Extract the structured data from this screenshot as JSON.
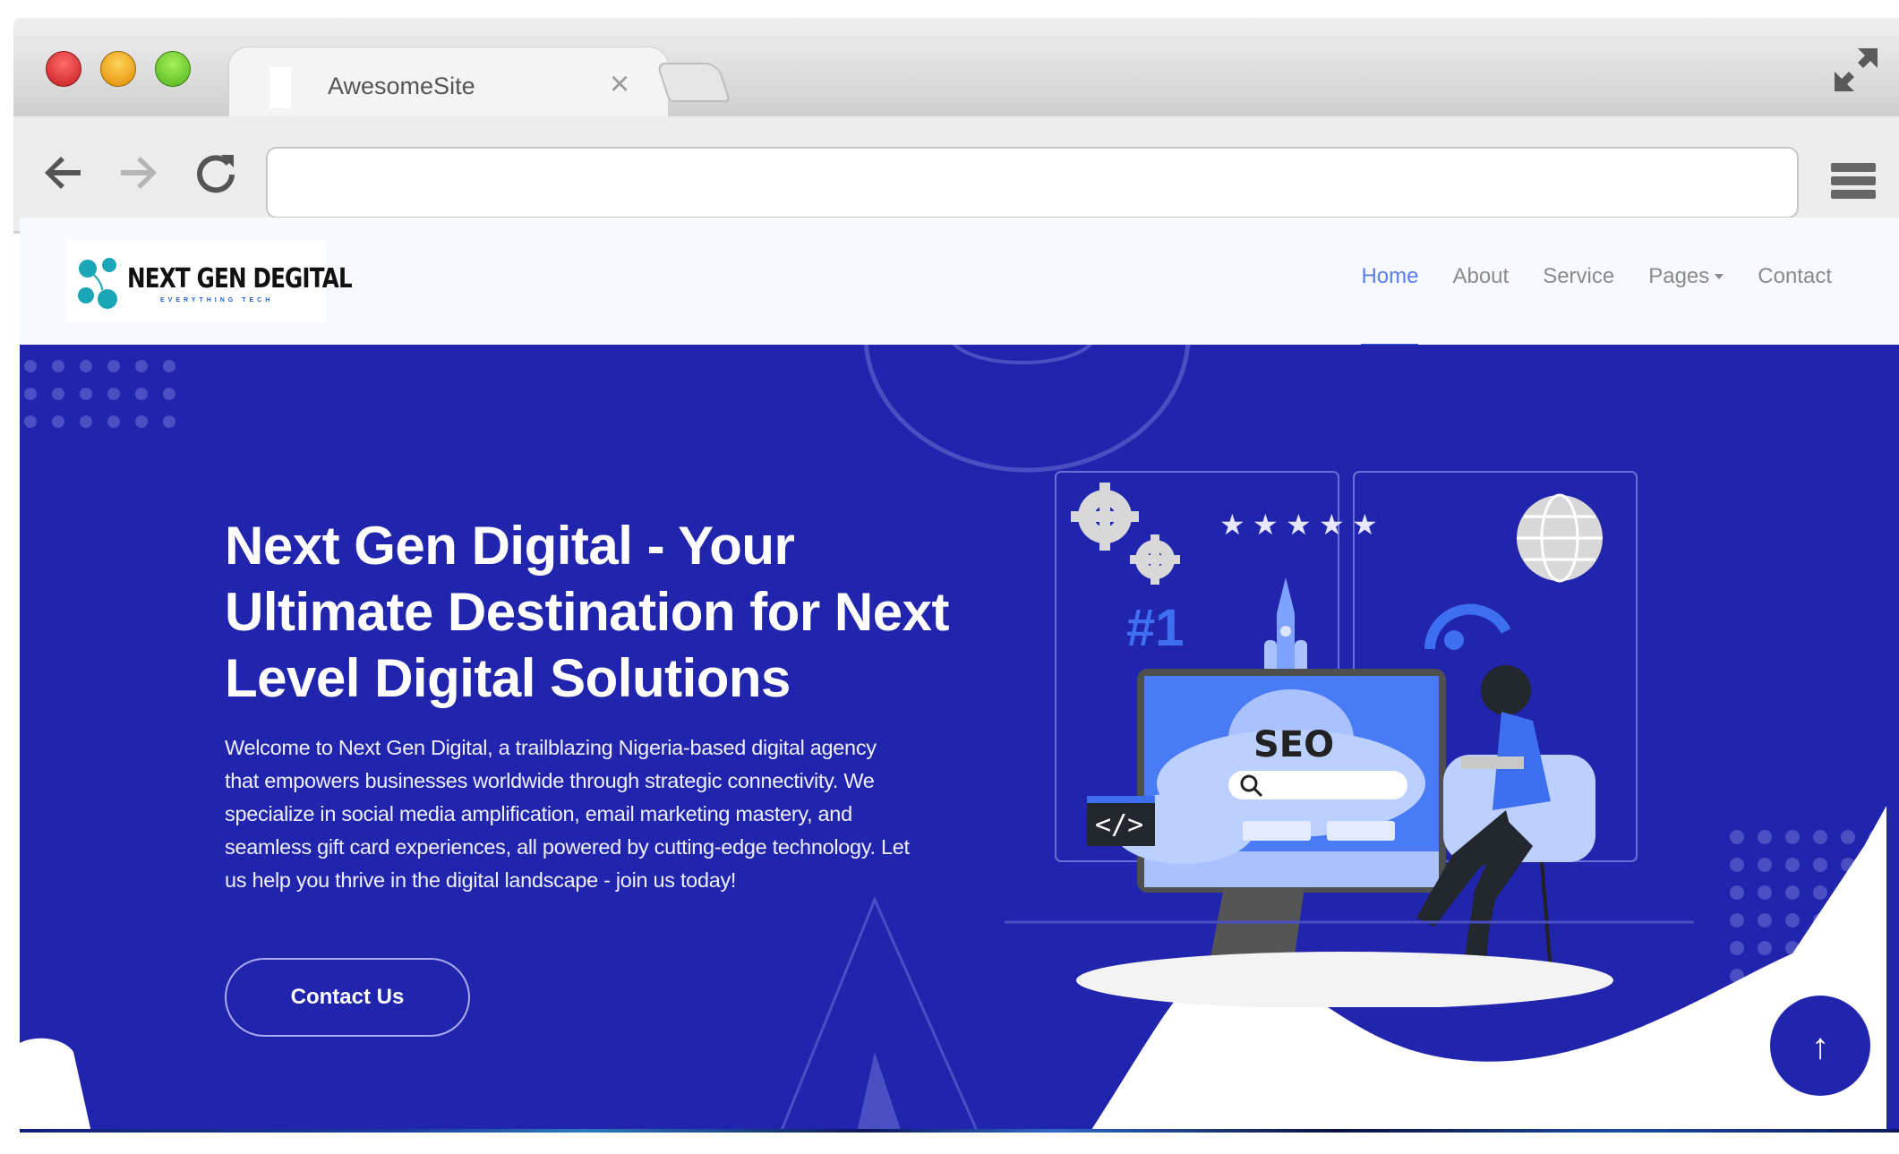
{
  "browser": {
    "tab_title": "AwesomeSite",
    "address_value": "",
    "icons": {
      "close": "close-icon",
      "back": "back-arrow-icon",
      "forward": "forward-arrow-icon",
      "reload": "reload-icon",
      "fullscreen": "fullscreen-icon",
      "menu": "hamburger-menu-icon"
    }
  },
  "site": {
    "logo": {
      "name": "NEXT GEN DEGITAL",
      "tagline": "EVERYTHING TECH",
      "color": "#1aa6b7"
    },
    "nav": [
      {
        "label": "Home",
        "active": true
      },
      {
        "label": "About",
        "active": false
      },
      {
        "label": "Service",
        "active": false
      },
      {
        "label": "Pages",
        "active": false,
        "dropdown": true
      },
      {
        "label": "Contact",
        "active": false
      }
    ],
    "hero": {
      "title": "Next Gen Digital - Your Ultimate Destination for Next Level Digital Solutions",
      "description": "Welcome to Next Gen Digital, a trailblazing Nigeria-based digital agency that empowers businesses worldwide through strategic connectivity. We specialize in social media amplification, email marketing mastery, and seamless gift card experiences, all powered by cutting-edge technology. Let us help you thrive in the digital landscape - join us today!",
      "cta_label": "Contact Us",
      "background_color": "#2124ad",
      "illustration": {
        "rank_label": "#1",
        "seo_label": "SEO",
        "code_label": "</>",
        "rating_stars": 5
      }
    },
    "back_to_top": "↑",
    "colors": {
      "nav_background": "#f6f9ff",
      "nav_active": "#5b7cf0",
      "nav_text": "#8a8a8a"
    }
  }
}
